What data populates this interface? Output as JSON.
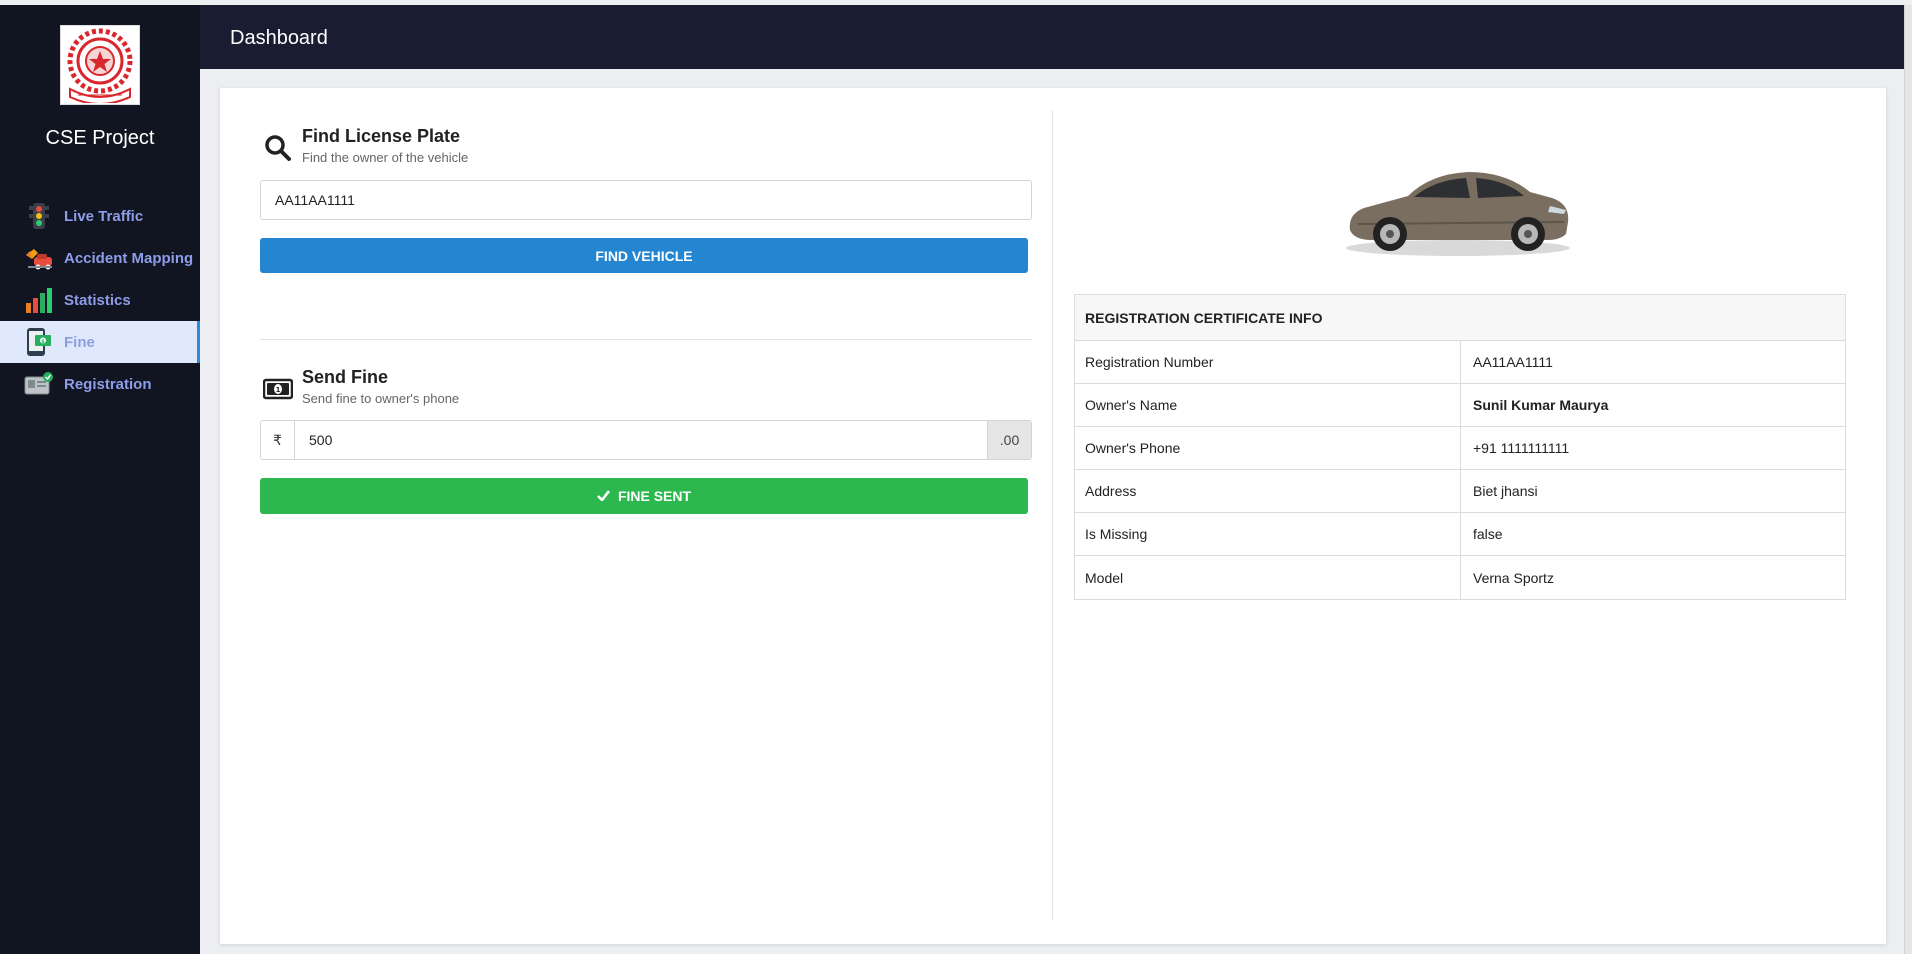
{
  "app": {
    "name": "CSE Project"
  },
  "header": {
    "title": "Dashboard"
  },
  "sidebar": {
    "items": [
      {
        "label": "Live Traffic",
        "icon": "traffic-light-icon"
      },
      {
        "label": "Accident Mapping",
        "icon": "car-crash-icon"
      },
      {
        "label": "Statistics",
        "icon": "bar-chart-icon"
      },
      {
        "label": "Fine",
        "icon": "fine-phone-icon",
        "active": true
      },
      {
        "label": "Registration",
        "icon": "registration-card-icon"
      }
    ]
  },
  "find": {
    "title": "Find License Plate",
    "subtitle": "Find the owner of the vehicle",
    "plate_value": "AA11AA1111",
    "button_label": "FIND VEHICLE"
  },
  "fine": {
    "title": "Send Fine",
    "subtitle": "Send fine to owner's phone",
    "currency": "₹",
    "amount": "500",
    "suffix": ".00",
    "button_label": "FINE SENT"
  },
  "rc": {
    "title": "REGISTRATION CERTIFICATE INFO",
    "rows": [
      {
        "key": "Registration Number",
        "value": "AA11AA1111"
      },
      {
        "key": "Owner's Name",
        "value": "Sunil Kumar Maurya"
      },
      {
        "key": "Owner's Phone",
        "value": "+91 1111111111"
      },
      {
        "key": "Address",
        "value": "Biet jhansi"
      },
      {
        "key": "Is Missing",
        "value": "false"
      },
      {
        "key": "Model",
        "value": "Verna Sportz"
      }
    ]
  },
  "colors": {
    "sidebar_bg": "#111421",
    "header_bg": "#1a1c32",
    "nav_text": "#8d9de8",
    "find_button": "#2486d1",
    "fine_button": "#2cb84e"
  }
}
